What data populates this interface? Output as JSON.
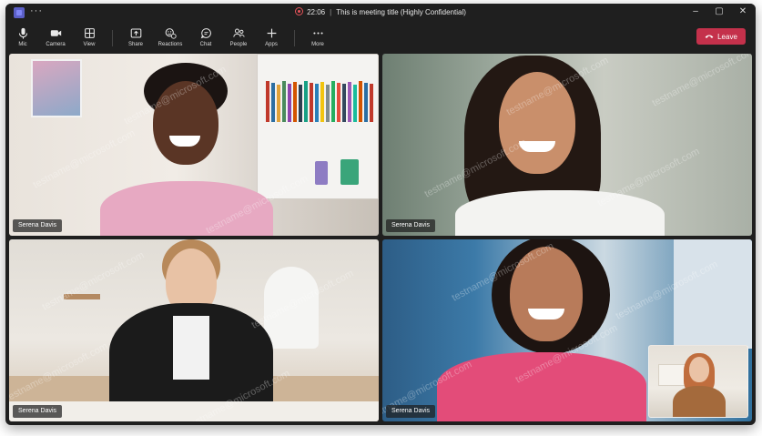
{
  "titlebar": {
    "more": "···",
    "timer": "22:06",
    "title": "This is meeting title (Highly Confidential)",
    "controls": [
      "–",
      "▢",
      "✕"
    ]
  },
  "toolbar": {
    "mic": "Mic",
    "camera": "Camera",
    "view": "View",
    "share": "Share",
    "reactions": "Reactions",
    "chat": "Chat",
    "people": "People",
    "apps": "Apps",
    "more": "More",
    "leave": "Leave"
  },
  "colors": {
    "leave_button": "#c4314b",
    "app_accent": "#5b5fc7",
    "recording": "#e8545a"
  },
  "participants": [
    {
      "name": "Serena Davis"
    },
    {
      "name": "Serena Davis"
    },
    {
      "name": "Serena Davis"
    },
    {
      "name": "Serena Davis"
    }
  ],
  "watermark": "testname@microsoft.com"
}
